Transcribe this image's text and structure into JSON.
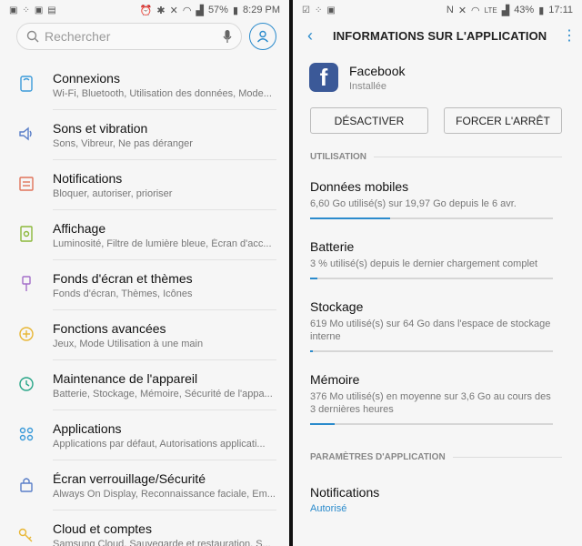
{
  "left": {
    "status": {
      "battery": "57%",
      "time": "8:29 PM"
    },
    "search": {
      "placeholder": "Rechercher"
    },
    "items": [
      {
        "title": "Connexions",
        "sub": "Wi-Fi, Bluetooth, Utilisation des données, Mode...",
        "icon": "connections-icon",
        "color": "#3a9ad9"
      },
      {
        "title": "Sons et vibration",
        "sub": "Sons, Vibreur, Ne pas déranger",
        "icon": "speaker-icon",
        "color": "#5a7fc8"
      },
      {
        "title": "Notifications",
        "sub": "Bloquer, autoriser, prioriser",
        "icon": "notification-icon",
        "color": "#e0735a"
      },
      {
        "title": "Affichage",
        "sub": "Luminosité, Filtre de lumière bleue, Écran d'acc...",
        "icon": "display-icon",
        "color": "#8bb83a"
      },
      {
        "title": "Fonds d'écran et thèmes",
        "sub": "Fonds d'écran, Thèmes, Icônes",
        "icon": "brush-icon",
        "color": "#a36ec9"
      },
      {
        "title": "Fonctions avancées",
        "sub": "Jeux, Mode Utilisation à une main",
        "icon": "gear-plus-icon",
        "color": "#e8b634"
      },
      {
        "title": "Maintenance de l'appareil",
        "sub": "Batterie, Stockage, Mémoire, Sécurité de l'appa...",
        "icon": "maintenance-icon",
        "color": "#27a587"
      },
      {
        "title": "Applications",
        "sub": "Applications par défaut, Autorisations applicati...",
        "icon": "apps-icon",
        "color": "#3a9ad9"
      },
      {
        "title": "Écran verrouillage/Sécurité",
        "sub": "Always On Display, Reconnaissance faciale, Em...",
        "icon": "lock-icon",
        "color": "#5a7fc8"
      },
      {
        "title": "Cloud et comptes",
        "sub": "Samsung Cloud, Sauvegarde et restauration, S...",
        "icon": "key-icon",
        "color": "#e8b634"
      }
    ]
  },
  "right": {
    "status": {
      "battery": "43%",
      "time": "17:11",
      "network": "LTE"
    },
    "header": {
      "title": "INFORMATIONS SUR L'APPLICATION"
    },
    "app": {
      "name": "Facebook",
      "status": "Installée",
      "logo_letter": "f"
    },
    "buttons": {
      "disable": "DÉSACTIVER",
      "force_stop": "FORCER L'ARRÊT"
    },
    "usage_section": "UTILISATION",
    "usage": [
      {
        "title": "Données mobiles",
        "sub": "6,60 Go utilisé(s) sur 19,97 Go depuis le 6 avr.",
        "fill": 0.33
      },
      {
        "title": "Batterie",
        "sub": "3 % utilisé(s) depuis le dernier chargement complet",
        "fill": 0.03
      },
      {
        "title": "Stockage",
        "sub": "619 Mo utilisé(s) sur 64 Go dans l'espace de stockage interne",
        "fill": 0.01
      },
      {
        "title": "Mémoire",
        "sub": "376 Mo utilisé(s) en moyenne sur 3,6 Go au cours des 3 dernières heures",
        "fill": 0.1
      }
    ],
    "params_section": "PARAMÈTRES D'APPLICATION",
    "notifications": {
      "title": "Notifications",
      "value": "Autorisé"
    }
  }
}
